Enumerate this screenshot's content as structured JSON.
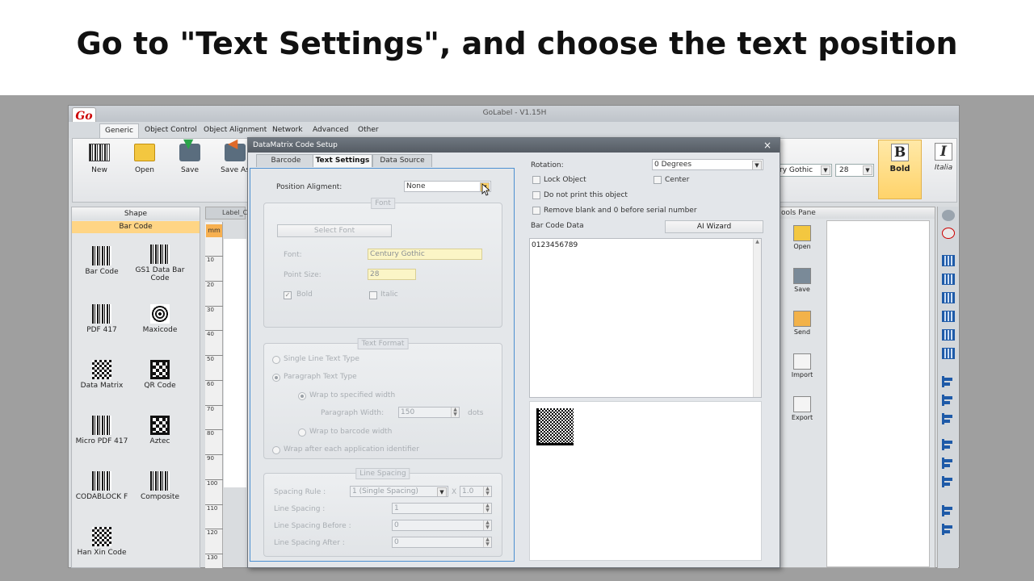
{
  "caption": "Go to \"Text Settings\", and choose the text position",
  "app": {
    "title": "GoLabel - V1.15H",
    "logo": "Go",
    "menu": [
      "Generic",
      "Object Control",
      "Object Alignment",
      "Network",
      "Advanced",
      "Other"
    ],
    "ribbon": {
      "buttons": [
        "New",
        "Open",
        "Save",
        "Save As"
      ],
      "font_value": "ry Gothic",
      "size_value": "28",
      "bold_label": "Bold",
      "bold_glyph": "B",
      "italic_label": "Italia",
      "italic_glyph": "I"
    }
  },
  "shape_panel": {
    "header": "Shape",
    "category": "Bar Code",
    "items": [
      "Bar Code",
      "GS1 Data Bar Code",
      "PDF 417",
      "Maxicode",
      "Data Matrix",
      "QR Code",
      "Micro PDF 417",
      "Aztec",
      "CODABLOCK F",
      "Composite",
      "Han Xin Code"
    ]
  },
  "label_tab": "Label_C",
  "ruler": {
    "unit": "mm",
    "ticks": [
      "10",
      "20",
      "30",
      "40",
      "50",
      "60",
      "70",
      "80",
      "90",
      "100",
      "110",
      "120",
      "130"
    ]
  },
  "tools_pane": {
    "header": "ools Pane",
    "items": [
      "Open",
      "Save",
      "Send",
      "Import",
      "Export"
    ]
  },
  "dialog": {
    "title": "DataMatrix Code Setup",
    "close": "×",
    "tabs": [
      "Barcode",
      "Text Settings",
      "Data Source"
    ],
    "position_alignment_label": "Position Aligment:",
    "position_alignment_value": "None",
    "font_group": {
      "title": "Font",
      "select_font": "Select Font",
      "font_label": "Font:",
      "font_value": "Century Gothic",
      "point_size_label": "Point Size:",
      "point_size_value": "28",
      "bold": "Bold",
      "italic": "Italic"
    },
    "text_format_group": {
      "title": "Text Format",
      "single_line": "Single Line Text Type",
      "paragraph": "Paragraph Text Type",
      "wrap_width": "Wrap to specified width",
      "paragraph_width_label": "Paragraph Width:",
      "paragraph_width_value": "150",
      "paragraph_width_unit": "dots",
      "wrap_barcode": "Wrap to barcode width",
      "wrap_after": "Wrap after each application identifier"
    },
    "line_spacing_group": {
      "title": "Line Spacing",
      "rule_label": "Spacing Rule :",
      "rule_value": "1 (Single Spacing)",
      "multiplier_x": "X",
      "multiplier_value": "1.0",
      "line_spacing_label": "Line Spacing :",
      "line_spacing_value": "1",
      "before_label": "Line Spacing Before :",
      "before_value": "0",
      "after_label": "Line Spacing After :",
      "after_value": "0"
    },
    "right": {
      "rotation_label": "Rotation:",
      "rotation_value": "0 Degrees",
      "lock_object": "Lock Object",
      "center": "Center",
      "do_not_print": "Do not print this object",
      "remove_blank": "Remove blank and 0 before serial number",
      "barcode_data_label": "Bar Code Data",
      "ai_wizard": "AI Wizard",
      "barcode_data_value": "0123456789"
    }
  }
}
